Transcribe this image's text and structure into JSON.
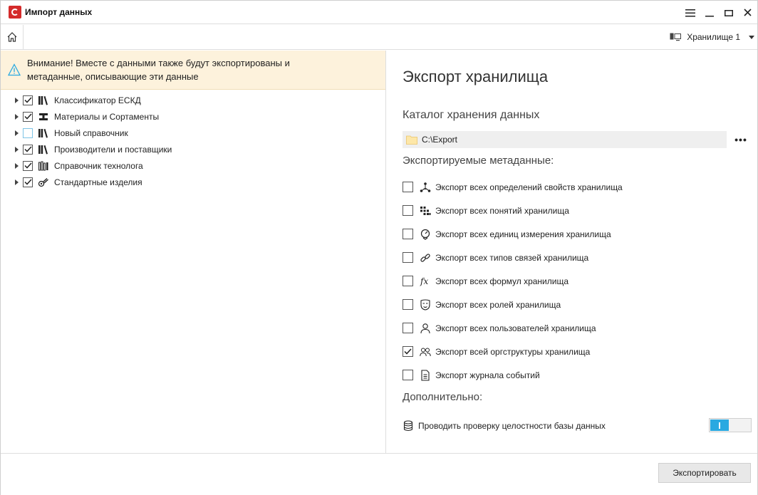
{
  "window": {
    "title": "Импорт данных"
  },
  "toolbar": {
    "storage_label": "Хранилище 1"
  },
  "warning": {
    "line1": "Внимание! Вместе с данными также будут экспортированы и",
    "line2": "метаданные, описывающие эти данные"
  },
  "tree": {
    "items": [
      {
        "label": "Классификатор ЕСКД",
        "checked": true,
        "icon": "books-icon"
      },
      {
        "label": "Материалы и Сортаменты",
        "checked": true,
        "icon": "materials-icon"
      },
      {
        "label": "Новый справочник",
        "checked": false,
        "icon": "books-icon"
      },
      {
        "label": "Производители и поставщики",
        "checked": true,
        "icon": "books-icon"
      },
      {
        "label": "Справочник технолога",
        "checked": true,
        "icon": "tools-icon"
      },
      {
        "label": "Стандартные изделия",
        "checked": true,
        "icon": "parts-icon"
      }
    ]
  },
  "export": {
    "heading": "Экспорт хранилища",
    "catalog_heading": "Каталог хранения данных",
    "path": "C:\\Export",
    "more": "•••",
    "metadata_heading": "Экспортируемые метаданные:",
    "metadata": [
      {
        "label": "Экспорт всех определений свойств хранилища",
        "checked": false,
        "icon": "properties-icon"
      },
      {
        "label": "Экспорт всех понятий хранилища",
        "checked": false,
        "icon": "concepts-icon"
      },
      {
        "label": "Экспорт всех единиц измерения хранилища",
        "checked": false,
        "icon": "units-icon"
      },
      {
        "label": "Экспорт всех типов связей хранилища",
        "checked": false,
        "icon": "link-icon"
      },
      {
        "label": "Экспорт всех формул хранилища",
        "checked": false,
        "icon": "formula-icon"
      },
      {
        "label": "Экспорт всех ролей хранилища",
        "checked": false,
        "icon": "roles-icon"
      },
      {
        "label": "Экспорт всех пользователей хранилища",
        "checked": false,
        "icon": "user-icon"
      },
      {
        "label": "Экспорт всей оргструктуры хранилища",
        "checked": true,
        "icon": "users-icon"
      },
      {
        "label": "Экспорт журнала событий",
        "checked": false,
        "icon": "log-icon"
      }
    ],
    "extra_heading": "Дополнительно:",
    "integrity_label": "Проводить проверку целостности базы данных",
    "integrity_enabled": true
  },
  "footer": {
    "export_button": "Экспортировать"
  },
  "colors": {
    "accent": "#29a9e1",
    "warning_bg": "#fdf2dc",
    "brand": "#d42b2b"
  }
}
